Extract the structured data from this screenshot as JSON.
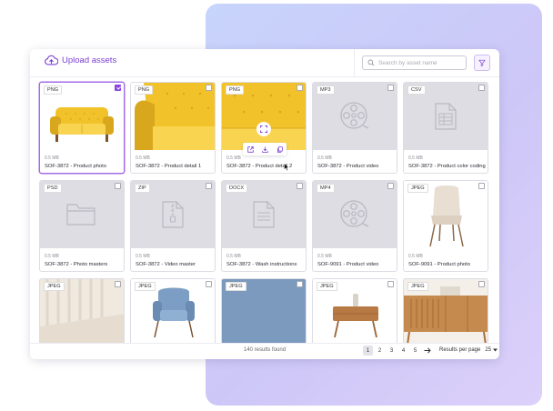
{
  "header": {
    "upload_label": "Upload assets",
    "search_placeholder": "Search by asset name"
  },
  "icons": {
    "upload": "cloud-upload-icon",
    "search": "search-icon",
    "filter": "filter-icon",
    "video_placeholder": "film-reel-icon",
    "table_placeholder": "spreadsheet-icon",
    "folder_placeholder": "folder-icon",
    "zip_placeholder": "zip-file-icon",
    "doc_placeholder": "document-icon",
    "expand": "expand-icon",
    "open": "open-external-icon",
    "download": "download-icon",
    "copy": "copy-icon",
    "next": "arrow-right-icon"
  },
  "colors": {
    "accent": "#8a44e0",
    "yellow": "#f2c22b",
    "placeholder_bg": "#dedde3"
  },
  "assets": [
    {
      "type": "PNG",
      "size": "0.5 MB",
      "title": "SOF-3872 - Product photo",
      "selected": true
    },
    {
      "type": "PNG",
      "size": "0.5 MB",
      "title": "SOF-3872 - Product detail 1",
      "selected": false
    },
    {
      "type": "PNG",
      "size": "0.5 MB",
      "title": "SOF-3872 - Product detail 2",
      "selected": false,
      "hovered": true
    },
    {
      "type": "MP3",
      "size": "0.5 MB",
      "title": "SOF-3872 - Product video",
      "selected": false
    },
    {
      "type": "CSV",
      "size": "0.5 MB",
      "title": "SOF-3872 - Product color coding",
      "selected": false
    },
    {
      "type": "PSD",
      "size": "0.5 MB",
      "title": "SOF-3872 - Photo masters",
      "selected": false
    },
    {
      "type": "ZIP",
      "size": "0.5 MB",
      "title": "SOF-3872 - Video master",
      "selected": false
    },
    {
      "type": "DOCX",
      "size": "0.5 MB",
      "title": "SOF-3872 - Wash instructions",
      "selected": false
    },
    {
      "type": "MP4",
      "size": "0.5 MB",
      "title": "SOF-9091 - Product video",
      "selected": false
    },
    {
      "type": "JPEG",
      "size": "0.5 MB",
      "title": "SOF-9091 - Product photo",
      "selected": false
    },
    {
      "type": "JPEG",
      "selected": false
    },
    {
      "type": "JPEG",
      "selected": false
    },
    {
      "type": "JPEG",
      "selected": false
    },
    {
      "type": "JPEG",
      "selected": false
    },
    {
      "type": "JPEG",
      "selected": false
    }
  ],
  "footer": {
    "results_count": "140 results found",
    "pages": [
      "1",
      "2",
      "3",
      "4",
      "5"
    ],
    "current_page": "1",
    "results_per_page_label": "Results per page",
    "results_per_page_value": "25"
  }
}
